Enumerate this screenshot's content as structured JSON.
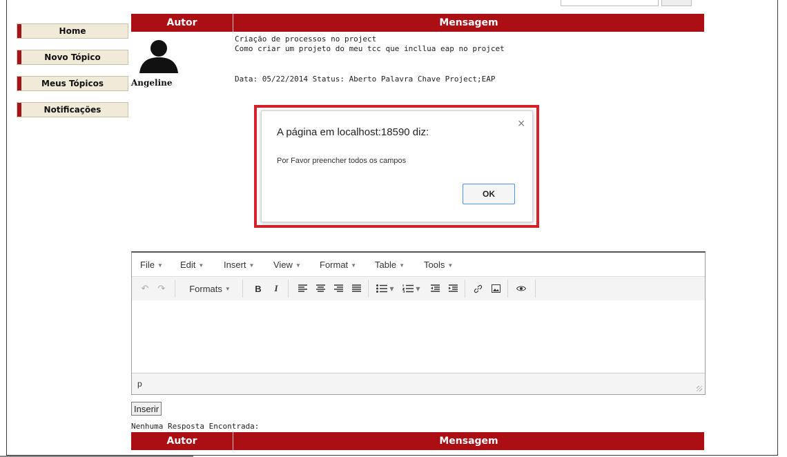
{
  "sidebar": {
    "items": [
      {
        "label": "Home"
      },
      {
        "label": "Novo Tópico"
      },
      {
        "label": "Meus Tópicos"
      },
      {
        "label": "Notificações"
      }
    ]
  },
  "table": {
    "header_author": "Autor",
    "header_message": "Mensagem"
  },
  "post": {
    "author": "Angeline",
    "title": "Criação de processos no project",
    "body": "Como criar um projeto do meu tcc que incllua eap no projcet",
    "meta": "Data: 05/22/2014 Status: Aberto Palavra Chave Project;EAP"
  },
  "dialog": {
    "title": "A página em localhost:18590 diz:",
    "message": "Por Favor preencher todos os campos",
    "ok_label": "OK",
    "close_symbol": "×"
  },
  "editor": {
    "menu": [
      "File",
      "Edit",
      "Insert",
      "View",
      "Format",
      "Table",
      "Tools"
    ],
    "formats_label": "Formats",
    "status_path": "p"
  },
  "actions": {
    "insert_label": "Inserir"
  },
  "replies": {
    "empty_text": "Nenhuma Resposta Encontrada:"
  },
  "colors": {
    "accent": "#ab0f14",
    "dialog_outline": "#d5222a"
  }
}
